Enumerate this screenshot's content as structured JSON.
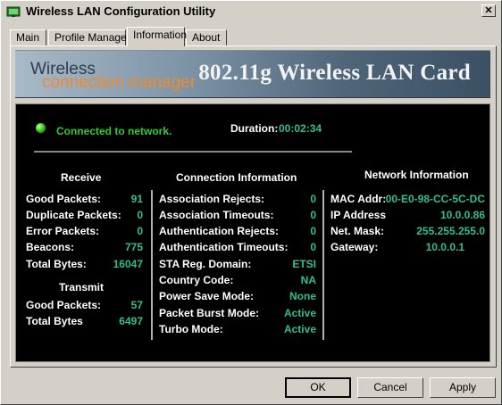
{
  "window": {
    "title": "Wireless LAN Configuration Utility",
    "close_glyph": "✕"
  },
  "tabs": [
    {
      "label": "Main"
    },
    {
      "label": "Profile Manager"
    },
    {
      "label": "Information"
    },
    {
      "label": "About"
    }
  ],
  "banner": {
    "brand_line1": "Wireless",
    "brand_line2": "connection manager",
    "product": "802.11g Wireless LAN Card"
  },
  "status": {
    "connection": "Connected to network.",
    "duration_label": "Duration:",
    "duration_value": "00:02:34"
  },
  "receive": {
    "header": "Receive",
    "rows": [
      {
        "label": "Good Packets:",
        "value": "91"
      },
      {
        "label": "Duplicate Packets:",
        "value": "0"
      },
      {
        "label": "Error Packets:",
        "value": "0"
      },
      {
        "label": "Beacons:",
        "value": "775"
      },
      {
        "label": "Total Bytes:",
        "value": "16047"
      }
    ]
  },
  "transmit": {
    "header": "Transmit",
    "rows": [
      {
        "label": "Good Packets:",
        "value": "57"
      },
      {
        "label": "Total Bytes",
        "value": "6497"
      }
    ]
  },
  "connection_info": {
    "header": "Connection Information",
    "rows": [
      {
        "label": "Association Rejects:",
        "value": "0"
      },
      {
        "label": "Association Timeouts:",
        "value": "0"
      },
      {
        "label": "Authentication Rejects:",
        "value": "0"
      },
      {
        "label": "Authentication Timeouts:",
        "value": "0"
      },
      {
        "label": "STA Reg. Domain:",
        "value": "ETSI"
      },
      {
        "label": "Country Code:",
        "value": "NA"
      },
      {
        "label": "Power Save Mode:",
        "value": "None"
      },
      {
        "label": "Packet Burst Mode:",
        "value": "Active"
      },
      {
        "label": "Turbo Mode:",
        "value": "Active"
      }
    ]
  },
  "network_info": {
    "header": "Network Information",
    "rows": [
      {
        "label": "MAC Addr:",
        "value": "00-E0-98-CC-5C-DC"
      },
      {
        "label": "IP Address",
        "value": "10.0.0.86"
      },
      {
        "label": "Net. Mask:",
        "value": "255.255.255.0"
      },
      {
        "label": "Gateway:",
        "value": "10.0.0.1"
      }
    ]
  },
  "buttons": {
    "ok": "OK",
    "cancel": "Cancel",
    "apply": "Apply"
  },
  "colors": {
    "value_green": "#2fc08a",
    "status_green": "#30cc30",
    "panel_bg": "#000000",
    "brand_orange": "#f08a2a"
  }
}
